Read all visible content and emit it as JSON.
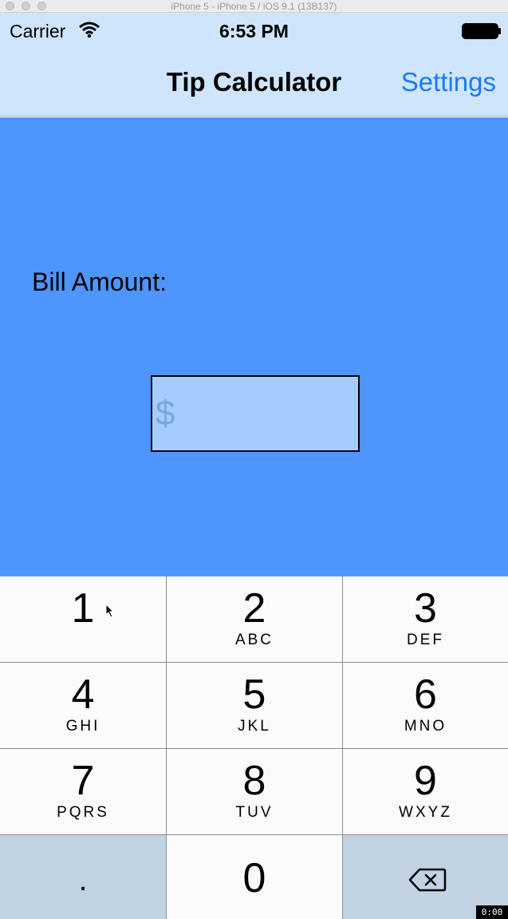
{
  "window": {
    "title": "iPhone 5 - iPhone 5 / iOS 9.1 (13B137)"
  },
  "status_bar": {
    "carrier": "Carrier",
    "time": "6:53 PM"
  },
  "nav": {
    "title": "Tip Calculator",
    "settings_label": "Settings"
  },
  "main": {
    "bill_label": "Bill Amount:",
    "bill_input": {
      "value": "",
      "placeholder": "$"
    }
  },
  "keypad": {
    "keys": [
      {
        "num": "1",
        "letters": ""
      },
      {
        "num": "2",
        "letters": "ABC"
      },
      {
        "num": "3",
        "letters": "DEF"
      },
      {
        "num": "4",
        "letters": "GHI"
      },
      {
        "num": "5",
        "letters": "JKL"
      },
      {
        "num": "6",
        "letters": "MNO"
      },
      {
        "num": "7",
        "letters": "PQRS"
      },
      {
        "num": "8",
        "letters": "TUV"
      },
      {
        "num": "9",
        "letters": "WXYZ"
      }
    ],
    "decimal": ".",
    "zero": "0",
    "delete_icon": "delete-backspace-icon"
  },
  "recording_timer": "0:00",
  "colors": {
    "nav_background": "#cfe5fb",
    "content_background": "#4f95fe",
    "input_background": "#a4cdfd",
    "accent": "#1a7bfb",
    "keypad_dark_key": "#c1d3e2"
  }
}
